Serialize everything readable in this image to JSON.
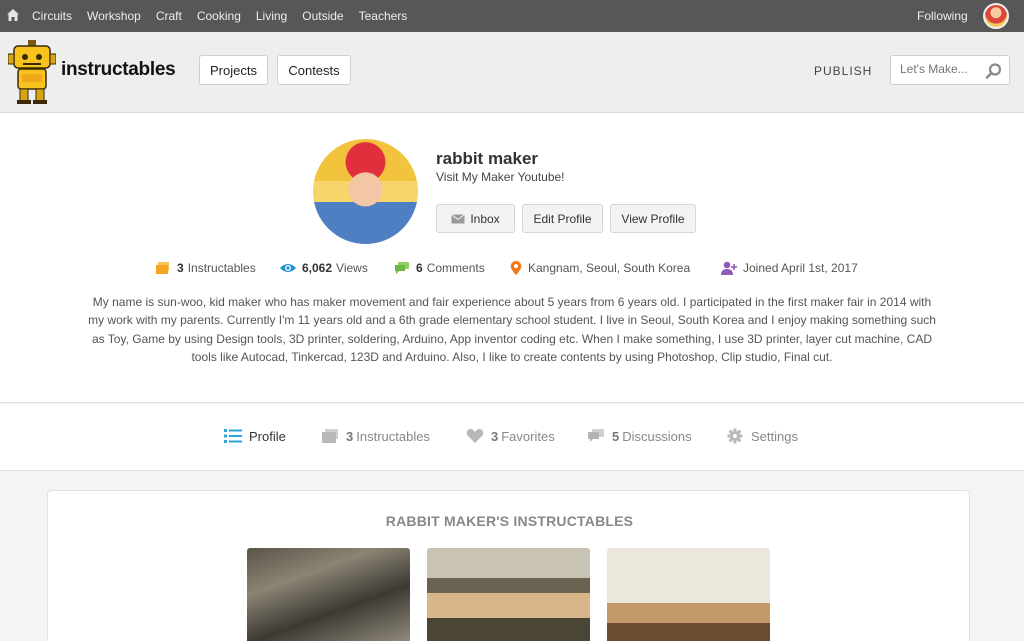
{
  "topnav": {
    "categories": [
      "Circuits",
      "Workshop",
      "Craft",
      "Cooking",
      "Living",
      "Outside",
      "Teachers"
    ],
    "following": "Following"
  },
  "header": {
    "logo_text": "instructables",
    "projects": "Projects",
    "contests": "Contests",
    "publish": "PUBLISH",
    "search_placeholder": "Let's Make..."
  },
  "profile": {
    "name": "rabbit maker",
    "tagline": "Visit My Maker Youtube!",
    "buttons": {
      "inbox": "Inbox",
      "edit": "Edit Profile",
      "view": "View Profile"
    },
    "stats": {
      "instructables_count": "3",
      "instructables_label": "Instructables",
      "views_count": "6,062",
      "views_label": "Views",
      "comments_count": "6",
      "comments_label": "Comments",
      "location": "Kangnam, Seoul, South Korea",
      "joined": "Joined April 1st, 2017"
    },
    "bio": "My name is sun-woo, kid maker who has maker movement and fair experience about 5 years from 6 years old. I participated in the first maker fair in 2014 with my work with my parents. Currently I'm 11 years old and a 6th grade elementary school student. I live in Seoul, South Korea and I enjoy making something such as Toy, Game by using Design tools, 3D printer, soldering, Arduino, App inventor coding etc. When I make something, I use 3D printer, layer cut machine, CAD tools like Autocad, Tinkercad, 123D and Arduino. Also, I like to create contents by using Photoshop, Clip studio, Final cut."
  },
  "tabs": {
    "profile": "Profile",
    "instructables_count": "3",
    "instructables": "Instructables",
    "favorites_count": "3",
    "favorites": "Favorites",
    "discussions_count": "5",
    "discussions": "Discussions",
    "settings": "Settings"
  },
  "section": {
    "title": "RABBIT MAKER'S INSTRUCTABLES"
  },
  "colors": {
    "topnav_bg": "#575757",
    "header_bg": "#eeeeee",
    "accent_blue": "#2aa6d6",
    "views_blue": "#1e8fd0",
    "comments_green": "#6bb944",
    "location_orange": "#f07a18",
    "joined_purple": "#8e5bb8",
    "instructables_orange": "#f5a623"
  }
}
